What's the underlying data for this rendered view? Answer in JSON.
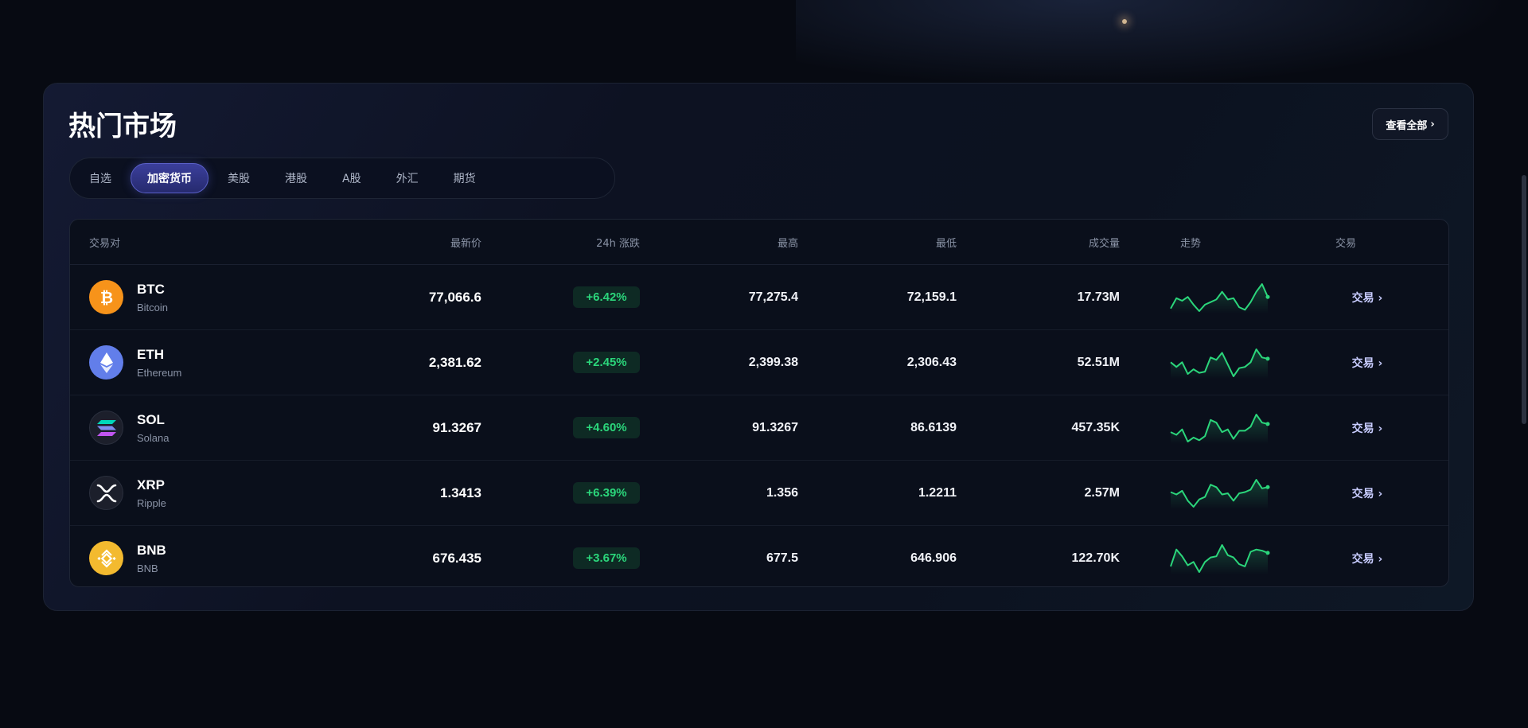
{
  "market": {
    "title": "热门市场",
    "view_all": "查看全部",
    "tabs": [
      {
        "label": "自选",
        "active": false
      },
      {
        "label": "加密货币",
        "active": true
      },
      {
        "label": "美股",
        "active": false
      },
      {
        "label": "港股",
        "active": false
      },
      {
        "label": "A股",
        "active": false
      },
      {
        "label": "外汇",
        "active": false
      },
      {
        "label": "期货",
        "active": false
      }
    ],
    "columns": {
      "pair": "交易对",
      "price": "最新价",
      "change": "24h 涨跌",
      "high": "最高",
      "low": "最低",
      "volume": "成交量",
      "trend": "走势",
      "trade": "交易"
    },
    "rows": [
      {
        "symbol": "BTC",
        "name": "Bitcoin",
        "price": "77,066.6",
        "change": "+6.42%",
        "high": "77,275.4",
        "low": "72,159.1",
        "volume": "17.73M",
        "trade": "交易",
        "icon": "bitcoin-icon",
        "icon_color": "#f7931a",
        "sparkline": [
          5,
          13,
          11,
          14,
          8,
          3,
          8,
          10,
          12,
          18,
          12,
          13,
          6,
          4,
          10,
          18,
          24,
          14
        ]
      },
      {
        "symbol": "ETH",
        "name": "Ethereum",
        "price": "2,381.62",
        "change": "+2.45%",
        "high": "2,399.38",
        "low": "2,306.43",
        "volume": "52.51M",
        "trade": "交易",
        "icon": "ethereum-icon",
        "icon_color": "#627eea",
        "sparkline": [
          14,
          10,
          14,
          4,
          8,
          5,
          6,
          18,
          16,
          22,
          12,
          2,
          9,
          10,
          14,
          25,
          18,
          17
        ]
      },
      {
        "symbol": "SOL",
        "name": "Solana",
        "price": "91.3267",
        "change": "+4.60%",
        "high": "91.3267",
        "low": "86.6139",
        "volume": "457.35K",
        "trade": "交易",
        "icon": "solana-icon",
        "icon_color": "#1c1f2b",
        "sparkline": [
          10,
          8,
          12,
          3,
          6,
          4,
          7,
          19,
          17,
          10,
          12,
          5,
          11,
          11,
          14,
          23,
          17,
          16
        ]
      },
      {
        "symbol": "XRP",
        "name": "Ripple",
        "price": "1.3413",
        "change": "+6.39%",
        "high": "1.356",
        "low": "1.2211",
        "volume": "2.57M",
        "trade": "交易",
        "icon": "ripple-icon",
        "icon_color": "#1c1f2b",
        "sparkline": [
          13,
          11,
          14,
          6,
          1,
          7,
          9,
          19,
          17,
          11,
          12,
          6,
          12,
          13,
          15,
          23,
          16,
          17
        ]
      },
      {
        "symbol": "BNB",
        "name": "BNB",
        "price": "676.435",
        "change": "+3.67%",
        "high": "677.5",
        "low": "646.906",
        "volume": "122.70K",
        "trade": "交易",
        "icon": "bnb-icon",
        "icon_color": "#f3ba2f",
        "sparkline": [
          5,
          20,
          14,
          6,
          9,
          0,
          9,
          13,
          14,
          24,
          15,
          13,
          7,
          5,
          18,
          20,
          19,
          17
        ]
      }
    ]
  },
  "colors": {
    "accent": "#3b3f9c",
    "up": "#2bd67b",
    "up_bg": "#0e2a24",
    "background": "#070a12"
  }
}
